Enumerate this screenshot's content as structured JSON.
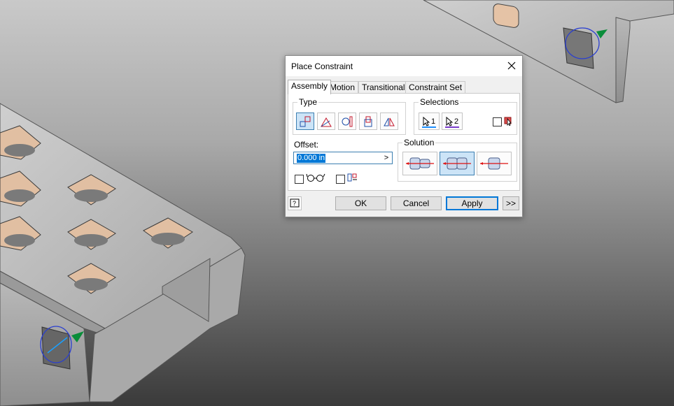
{
  "dialog": {
    "title": "Place Constraint",
    "close_glyph": "✕",
    "tabs": [
      "Assembly",
      "Motion",
      "Transitional",
      "Constraint Set"
    ],
    "type_group": {
      "label": "Type"
    },
    "selections_group": {
      "label": "Selections",
      "sel1": "1",
      "sel2": "2"
    },
    "offset": {
      "label": "Offset:",
      "value": "0.000 in",
      "arrow": ">"
    },
    "solution_group": {
      "label": "Solution"
    },
    "buttons": {
      "ok": "OK",
      "cancel": "Cancel",
      "apply": "Apply",
      "more": ">>"
    },
    "help_icon": "help-icon"
  },
  "colors": {
    "accent": "#0078d7",
    "selected_fill": "#cce4f7",
    "highlight": "#1e90ff"
  }
}
